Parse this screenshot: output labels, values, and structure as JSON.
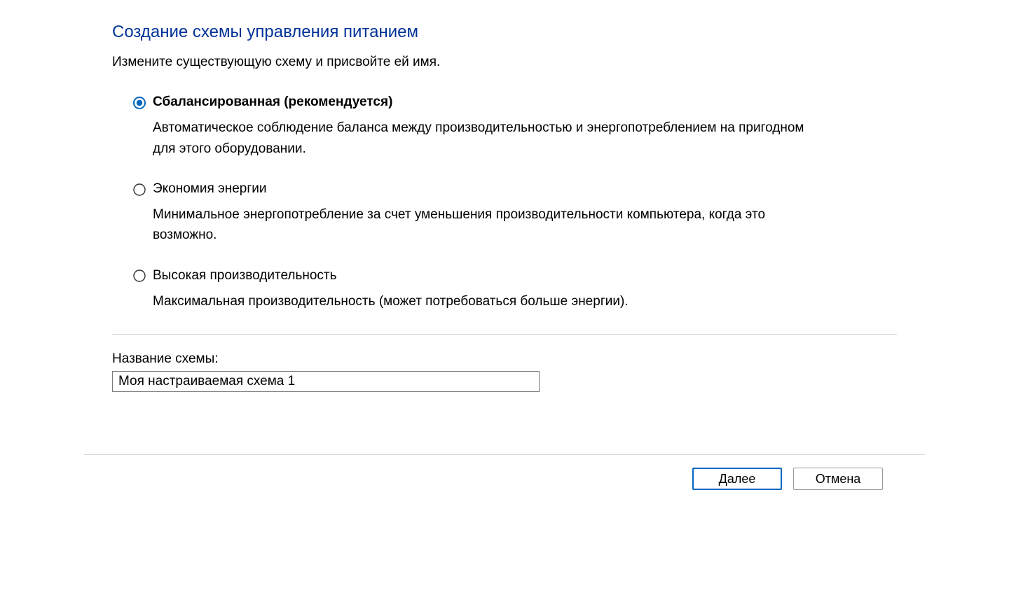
{
  "title": "Создание схемы управления питанием",
  "instruction": "Измените существующую схему и присвойте ей имя.",
  "options": [
    {
      "label": "Сбалансированная (рекомендуется)",
      "description": "Автоматическое соблюдение баланса между производительностью и энергопотреблением на пригодном для этого оборудовании.",
      "selected": true
    },
    {
      "label": "Экономия энергии",
      "description": "Минимальное энергопотребление за счет уменьшения производительности компьютера, когда это возможно.",
      "selected": false
    },
    {
      "label": "Высокая производительность",
      "description": "Максимальная производительность (может потребоваться больше энергии).",
      "selected": false
    }
  ],
  "plan_name_label": "Название схемы:",
  "plan_name_value": "Моя настраиваемая схема 1",
  "buttons": {
    "next": "Далее",
    "cancel": "Отмена"
  }
}
